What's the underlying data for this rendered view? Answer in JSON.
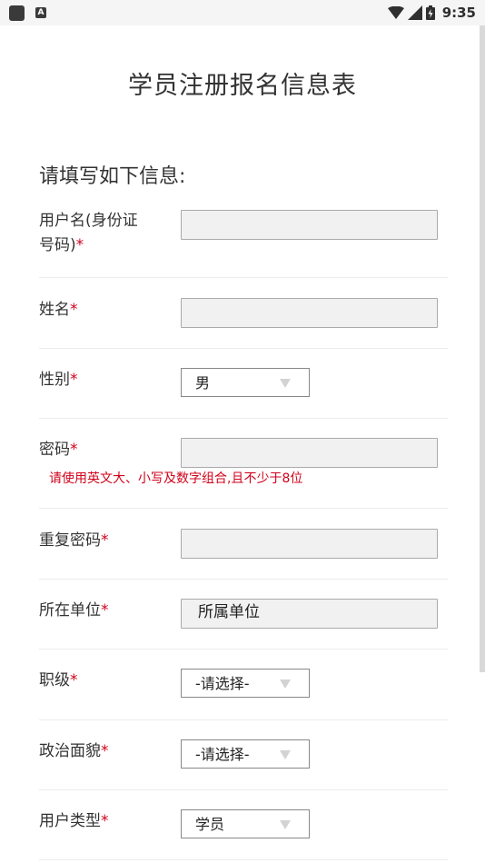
{
  "status_bar": {
    "time": "9:35",
    "left_icons": [
      "app-icon",
      "text-icon"
    ],
    "right_icons": [
      "wifi-icon",
      "signal-icon",
      "battery-icon"
    ]
  },
  "page": {
    "title": "学员注册报名信息表",
    "section_title": "请填写如下信息:"
  },
  "required_mark": "*",
  "form": {
    "username": {
      "label_line1": "用户名(身份证",
      "label_line2": "号码)",
      "value": ""
    },
    "name": {
      "label": "姓名",
      "value": ""
    },
    "gender": {
      "label": "性别",
      "value": "男"
    },
    "password": {
      "label": "密码",
      "value": "",
      "hint": "请使用英文大、小写及数字组合,且不少于8位"
    },
    "repeat_password": {
      "label": "重复密码",
      "value": ""
    },
    "unit": {
      "label": "所在单位",
      "value": "所属单位"
    },
    "rank": {
      "label": "职级",
      "value": "-请选择-"
    },
    "political": {
      "label": "政治面貌",
      "value": "-请选择-"
    },
    "user_type": {
      "label": "用户类型",
      "value": "学员"
    }
  },
  "colors": {
    "required": "#d0021b",
    "hint": "#d0021b",
    "input_bg": "#f1f1f1",
    "status_bar_bg": "#f5f5f5"
  }
}
